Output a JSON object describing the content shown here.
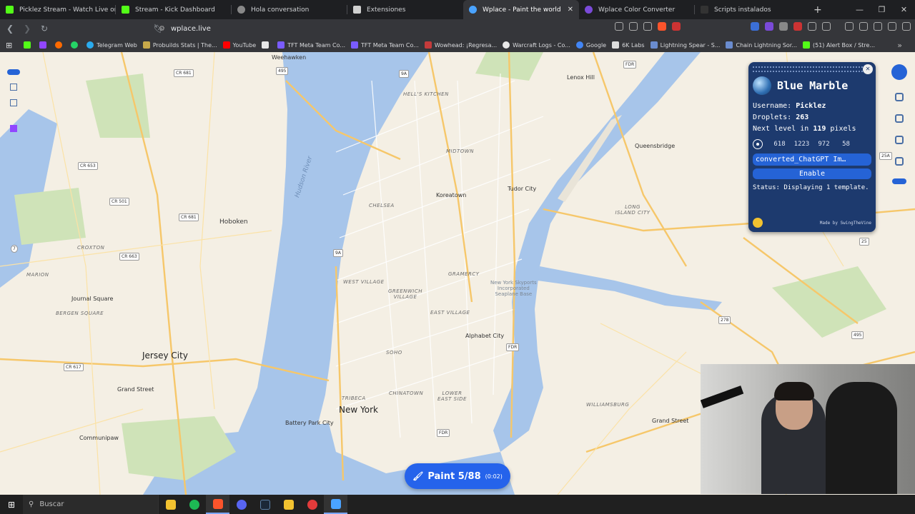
{
  "browser": {
    "tabs": [
      {
        "title": "Picklez Stream - Watch Live on Kick",
        "color": "#53fc18"
      },
      {
        "title": "Stream - Kick Dashboard",
        "color": "#53fc18"
      },
      {
        "title": "Hola conversation",
        "color": "#888888"
      },
      {
        "title": "Extensiones",
        "color": "#d0d0d0"
      },
      {
        "title": "Wplace - Paint the world",
        "color": "#4aa3ff",
        "active": true
      },
      {
        "title": "Wplace Color Converter",
        "color": "#7a4ad8"
      },
      {
        "title": "Scripts instalados",
        "color": "#333333"
      }
    ],
    "close_glyph": "✕",
    "newtab_glyph": "+",
    "window_controls": [
      "—",
      "❐",
      "✕"
    ],
    "url": "wplace.live",
    "bookmarks": [
      {
        "label": "",
        "color": "#53fc18"
      },
      {
        "label": "",
        "color": "#9146ff"
      },
      {
        "label": "",
        "color": "#ff6a00"
      },
      {
        "label": "",
        "color": "#25d366"
      },
      {
        "label": "Telegram Web",
        "color": "#2aabee"
      },
      {
        "label": "Probuilds Stats | The...",
        "color": "#c8a94a"
      },
      {
        "label": "YouTube",
        "color": "#ff0000"
      },
      {
        "label": "",
        "color": "#e8e8e8"
      },
      {
        "label": "TFT Meta Team Co...",
        "color": "#7a5cff"
      },
      {
        "label": "TFT Meta Team Co...",
        "color": "#7a5cff"
      },
      {
        "label": "Wowhead: ¡Regresa...",
        "color": "#c53b3b"
      },
      {
        "label": "Warcraft Logs - Co...",
        "color": "#e8e8e8"
      },
      {
        "label": "Google",
        "color": "#4285f4"
      },
      {
        "label": "6K Labs",
        "color": "#dddddd"
      },
      {
        "label": "Lightning Spear - S...",
        "color": "#6a8ccf"
      },
      {
        "label": "Chain Lightning Sor...",
        "color": "#6a8ccf"
      },
      {
        "label": "(51) Alert Box / Stre...",
        "color": "#53fc18"
      }
    ]
  },
  "map": {
    "labels": {
      "weehawken": "Weehawken",
      "hoboken": "Hoboken",
      "jersey_city": "Jersey City",
      "journal_square": "Journal Square",
      "bergen_square": "BERGEN SQUARE",
      "croxton": "CROXTON",
      "marion": "MARION",
      "communipaw": "Communipaw",
      "grand_street": "Grand Street",
      "battery_park": "Battery Park City",
      "new_york": "New York",
      "koreatown": "Koreatown",
      "tudor_city": "Tudor City",
      "queensbridge": "Queensbridge",
      "lenox_hill": "Lenox Hill",
      "long_island_city": "LONG ISLAND CITY",
      "midtown": "MIDTOWN",
      "chelsea": "CHELSEA",
      "hells_kitchen": "HELL'S KITCHEN",
      "gramercy": "GRAMERCY",
      "west_village": "WEST VILLAGE",
      "greenwich_village": "GREENWICH\nVILLAGE",
      "east_village": "EAST VILLAGE",
      "alphabet_city": "Alphabet City",
      "soho": "SOHO",
      "tribeca": "TRIBECA",
      "chinatown": "CHINATOWN",
      "lower_east_side": "LOWER\nEAST SIDE",
      "williamsburg": "WILLIAMSBURG",
      "grand_street_bk": "Grand Street",
      "skyports": "New York Skyports\nIncorporated\nSeaplane Base",
      "hudson": "Hudson River"
    },
    "shields": [
      "CR 681",
      "495",
      "9A",
      "FDR",
      "CR 653",
      "CR 501",
      "CR 681",
      "CR 663",
      "9A",
      "7",
      "CR 617",
      "FDR",
      "FDR",
      "278",
      "495",
      "25A",
      "25"
    ]
  },
  "panel": {
    "title": "Blue Marble",
    "username_label": "Username:",
    "username": "Picklez",
    "droplets_label": "Droplets:",
    "droplets": "263",
    "next_level_pre": "Next level in",
    "next_level_value": "119",
    "next_level_post": "pixels",
    "coords": [
      "618",
      "1223",
      "972",
      "58"
    ],
    "file": "converted_ChatGPT Im…",
    "enable": "Enable",
    "status": "Status: Displaying 1 template.",
    "footer": "Made by SwingTheVine",
    "close": "✕"
  },
  "paint": {
    "label": "Paint 5/88",
    "timer": "(0:02)"
  },
  "taskbar": {
    "search": "Buscar",
    "apps": [
      {
        "color": "#f2c230"
      },
      {
        "color": "#1db954"
      },
      {
        "color": "#fb542b",
        "active": true
      },
      {
        "color": "#5865f2"
      },
      {
        "color": "#1b2838"
      },
      {
        "color": "#f2c230"
      },
      {
        "color": "#e23b3b"
      },
      {
        "color": "#4aa3ff",
        "active": true
      }
    ]
  },
  "colors": {
    "panel_bg": "#1d3a6e",
    "accent": "#2563eb",
    "water": "#a7c5ea",
    "land": "#f4efe4",
    "park": "#cfe3b8"
  }
}
